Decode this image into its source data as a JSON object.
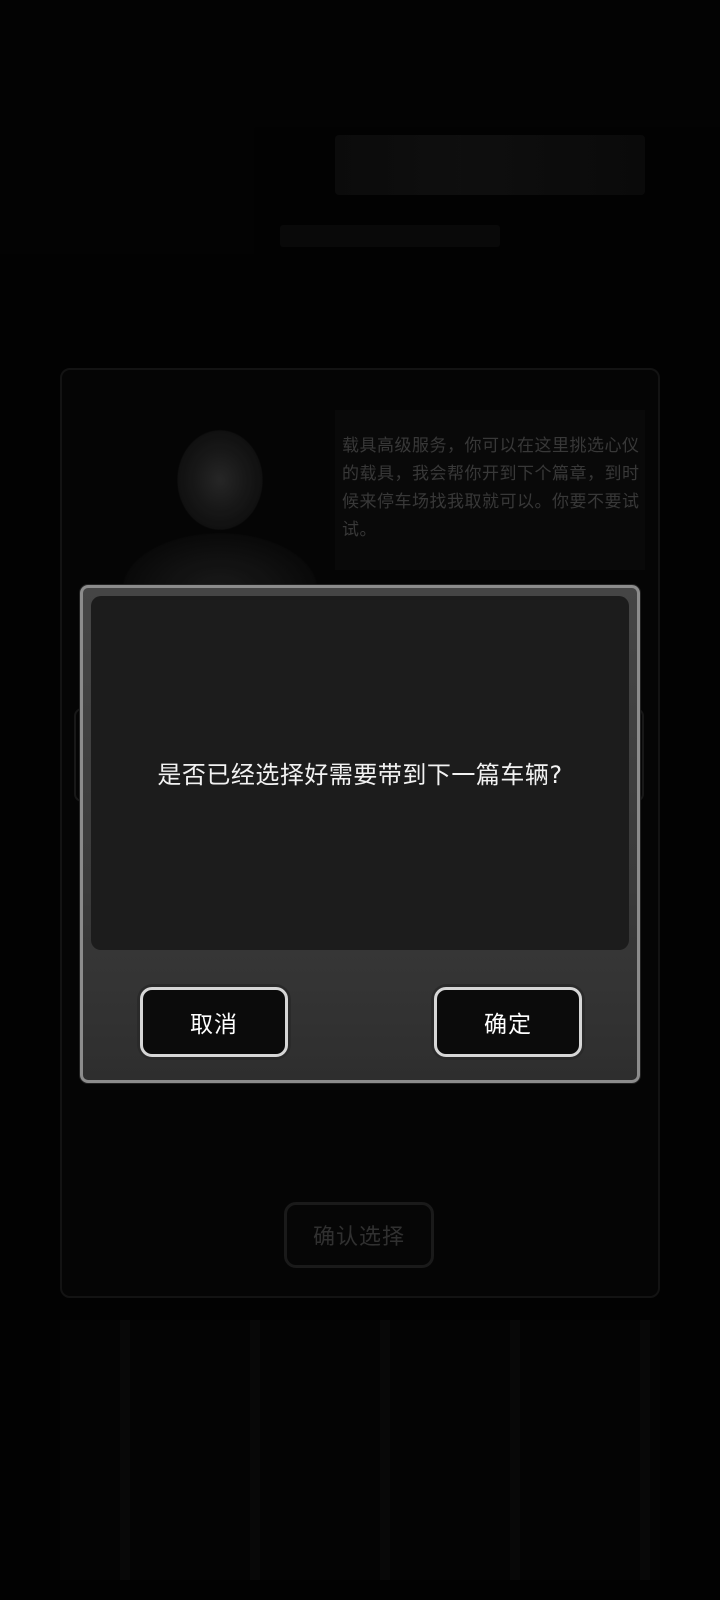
{
  "background": {
    "npc_speech": "载具高级服务，你可以在这里挑选心仪的载具，我会帮你开到下个篇章，到时候来停车场找我取就可以。你要不要试试。",
    "confirm_select_label": "确认选择"
  },
  "dialog": {
    "message": "是否已经选择好需要带到下一篇车辆?",
    "cancel_label": "取消",
    "ok_label": "确定"
  },
  "colors": {
    "dialog_frame": "#8c8c8c",
    "dialog_body": "#1c1c1c",
    "button_fill": "#0b0b0b",
    "button_border": "#d6d6d6"
  }
}
